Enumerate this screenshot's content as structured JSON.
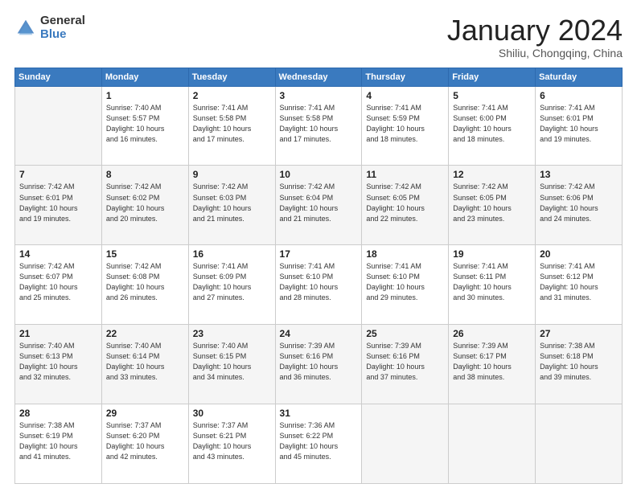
{
  "header": {
    "logo_general": "General",
    "logo_blue": "Blue",
    "title": "January 2024",
    "location": "Shiliu, Chongqing, China"
  },
  "calendar": {
    "days_of_week": [
      "Sunday",
      "Monday",
      "Tuesday",
      "Wednesday",
      "Thursday",
      "Friday",
      "Saturday"
    ],
    "weeks": [
      {
        "days": [
          {
            "number": "",
            "info": ""
          },
          {
            "number": "1",
            "info": "Sunrise: 7:40 AM\nSunset: 5:57 PM\nDaylight: 10 hours\nand 16 minutes."
          },
          {
            "number": "2",
            "info": "Sunrise: 7:41 AM\nSunset: 5:58 PM\nDaylight: 10 hours\nand 17 minutes."
          },
          {
            "number": "3",
            "info": "Sunrise: 7:41 AM\nSunset: 5:58 PM\nDaylight: 10 hours\nand 17 minutes."
          },
          {
            "number": "4",
            "info": "Sunrise: 7:41 AM\nSunset: 5:59 PM\nDaylight: 10 hours\nand 18 minutes."
          },
          {
            "number": "5",
            "info": "Sunrise: 7:41 AM\nSunset: 6:00 PM\nDaylight: 10 hours\nand 18 minutes."
          },
          {
            "number": "6",
            "info": "Sunrise: 7:41 AM\nSunset: 6:01 PM\nDaylight: 10 hours\nand 19 minutes."
          }
        ]
      },
      {
        "days": [
          {
            "number": "7",
            "info": "Sunrise: 7:42 AM\nSunset: 6:01 PM\nDaylight: 10 hours\nand 19 minutes."
          },
          {
            "number": "8",
            "info": "Sunrise: 7:42 AM\nSunset: 6:02 PM\nDaylight: 10 hours\nand 20 minutes."
          },
          {
            "number": "9",
            "info": "Sunrise: 7:42 AM\nSunset: 6:03 PM\nDaylight: 10 hours\nand 21 minutes."
          },
          {
            "number": "10",
            "info": "Sunrise: 7:42 AM\nSunset: 6:04 PM\nDaylight: 10 hours\nand 21 minutes."
          },
          {
            "number": "11",
            "info": "Sunrise: 7:42 AM\nSunset: 6:05 PM\nDaylight: 10 hours\nand 22 minutes."
          },
          {
            "number": "12",
            "info": "Sunrise: 7:42 AM\nSunset: 6:05 PM\nDaylight: 10 hours\nand 23 minutes."
          },
          {
            "number": "13",
            "info": "Sunrise: 7:42 AM\nSunset: 6:06 PM\nDaylight: 10 hours\nand 24 minutes."
          }
        ]
      },
      {
        "days": [
          {
            "number": "14",
            "info": "Sunrise: 7:42 AM\nSunset: 6:07 PM\nDaylight: 10 hours\nand 25 minutes."
          },
          {
            "number": "15",
            "info": "Sunrise: 7:42 AM\nSunset: 6:08 PM\nDaylight: 10 hours\nand 26 minutes."
          },
          {
            "number": "16",
            "info": "Sunrise: 7:41 AM\nSunset: 6:09 PM\nDaylight: 10 hours\nand 27 minutes."
          },
          {
            "number": "17",
            "info": "Sunrise: 7:41 AM\nSunset: 6:10 PM\nDaylight: 10 hours\nand 28 minutes."
          },
          {
            "number": "18",
            "info": "Sunrise: 7:41 AM\nSunset: 6:10 PM\nDaylight: 10 hours\nand 29 minutes."
          },
          {
            "number": "19",
            "info": "Sunrise: 7:41 AM\nSunset: 6:11 PM\nDaylight: 10 hours\nand 30 minutes."
          },
          {
            "number": "20",
            "info": "Sunrise: 7:41 AM\nSunset: 6:12 PM\nDaylight: 10 hours\nand 31 minutes."
          }
        ]
      },
      {
        "days": [
          {
            "number": "21",
            "info": "Sunrise: 7:40 AM\nSunset: 6:13 PM\nDaylight: 10 hours\nand 32 minutes."
          },
          {
            "number": "22",
            "info": "Sunrise: 7:40 AM\nSunset: 6:14 PM\nDaylight: 10 hours\nand 33 minutes."
          },
          {
            "number": "23",
            "info": "Sunrise: 7:40 AM\nSunset: 6:15 PM\nDaylight: 10 hours\nand 34 minutes."
          },
          {
            "number": "24",
            "info": "Sunrise: 7:39 AM\nSunset: 6:16 PM\nDaylight: 10 hours\nand 36 minutes."
          },
          {
            "number": "25",
            "info": "Sunrise: 7:39 AM\nSunset: 6:16 PM\nDaylight: 10 hours\nand 37 minutes."
          },
          {
            "number": "26",
            "info": "Sunrise: 7:39 AM\nSunset: 6:17 PM\nDaylight: 10 hours\nand 38 minutes."
          },
          {
            "number": "27",
            "info": "Sunrise: 7:38 AM\nSunset: 6:18 PM\nDaylight: 10 hours\nand 39 minutes."
          }
        ]
      },
      {
        "days": [
          {
            "number": "28",
            "info": "Sunrise: 7:38 AM\nSunset: 6:19 PM\nDaylight: 10 hours\nand 41 minutes."
          },
          {
            "number": "29",
            "info": "Sunrise: 7:37 AM\nSunset: 6:20 PM\nDaylight: 10 hours\nand 42 minutes."
          },
          {
            "number": "30",
            "info": "Sunrise: 7:37 AM\nSunset: 6:21 PM\nDaylight: 10 hours\nand 43 minutes."
          },
          {
            "number": "31",
            "info": "Sunrise: 7:36 AM\nSunset: 6:22 PM\nDaylight: 10 hours\nand 45 minutes."
          },
          {
            "number": "",
            "info": ""
          },
          {
            "number": "",
            "info": ""
          },
          {
            "number": "",
            "info": ""
          }
        ]
      }
    ]
  }
}
